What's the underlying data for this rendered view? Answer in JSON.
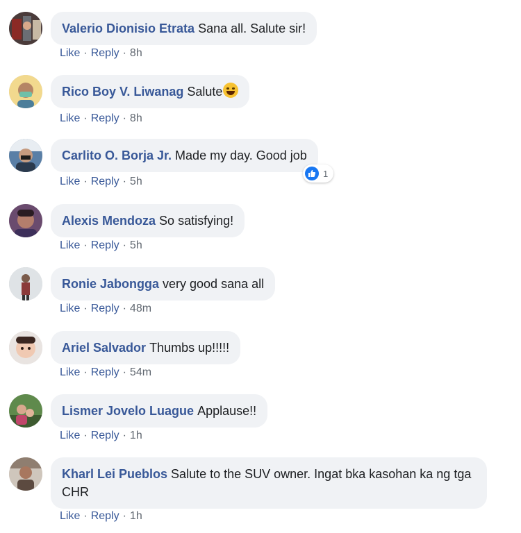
{
  "comments": [
    {
      "author": "Valerio Dionisio Etrata",
      "text": "Sana all. Salute sir!",
      "like": "Like",
      "reply": "Reply",
      "time": "8h",
      "avatar": "avatar-1"
    },
    {
      "author": "Rico Boy V. Liwanag",
      "text": "Salute",
      "like": "Like",
      "reply": "Reply",
      "time": "8h",
      "avatar": "avatar-2"
    },
    {
      "author": "Carlito O. Borja Jr.",
      "text": "Made my day. Good job",
      "like": "Like",
      "reply": "Reply",
      "time": "5h",
      "avatar": "avatar-3",
      "reaction_count": "1"
    },
    {
      "author": "Alexis Mendoza",
      "text": "So satisfying!",
      "like": "Like",
      "reply": "Reply",
      "time": "5h",
      "avatar": "avatar-4"
    },
    {
      "author": "Ronie Jabongga",
      "text": "very good sana all",
      "like": "Like",
      "reply": "Reply",
      "time": "48m",
      "avatar": "avatar-5"
    },
    {
      "author": "Ariel Salvador",
      "text": "Thumbs up!!!!!",
      "like": "Like",
      "reply": "Reply",
      "time": "54m",
      "avatar": "avatar-6"
    },
    {
      "author": "Lismer Jovelo Luague",
      "text": "Applause!!",
      "like": "Like",
      "reply": "Reply",
      "time": "1h",
      "avatar": "avatar-7"
    },
    {
      "author": "Kharl Lei Pueblos",
      "text": "Salute to the SUV owner. Ingat bka kasohan ka ng tga CHR",
      "like": "Like",
      "reply": "Reply",
      "time": "1h",
      "avatar": "avatar-8"
    }
  ],
  "separator": "·",
  "icons": {
    "emoji": "laughing-emoji-icon",
    "reaction": "like-reaction-icon"
  },
  "colors": {
    "author": "#385898",
    "bubble": "#f0f2f5",
    "meta": "#606770",
    "like_blue": "#1877f2"
  }
}
